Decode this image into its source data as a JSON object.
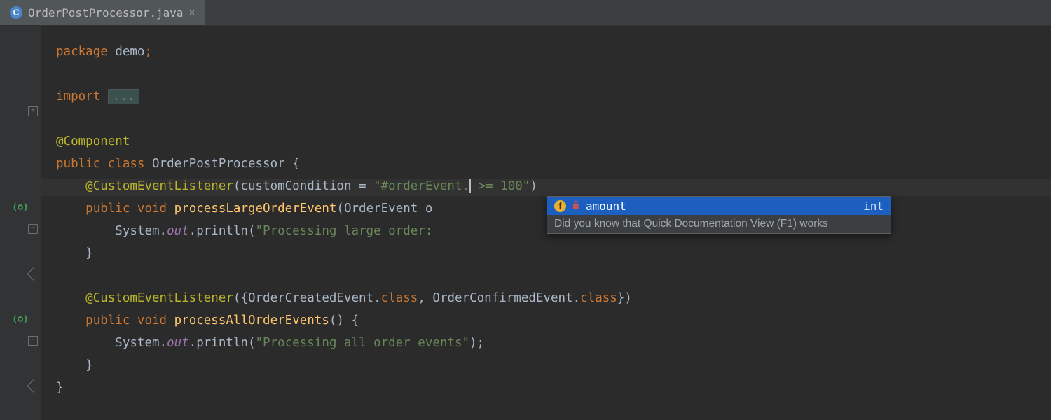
{
  "tab": {
    "filename": "OrderPostProcessor.java",
    "icon_letter": "C"
  },
  "code": {
    "l1": {
      "kw_package": "package",
      "pkg": "demo",
      "semi": ";"
    },
    "l3": {
      "kw_import": "import",
      "fold": "..."
    },
    "l5": {
      "ann": "@Component"
    },
    "l6": {
      "kw_public": "public",
      "kw_class": "class",
      "name": "OrderPostProcessor",
      "brace": " {"
    },
    "l7": {
      "ann": "@CustomEventListener",
      "paren_o": "(",
      "attr": "customCondition",
      "eq": " = ",
      "str_l": "\"#orderEvent.",
      "str_r": " >= 100\"",
      "paren_c": ")"
    },
    "l8": {
      "kw_public": "public",
      "kw_void": "void",
      "mname": "processLargeOrderEvent",
      "sig": "(OrderEvent o"
    },
    "l9": {
      "sys": "System.",
      "out": "out",
      "print": ".println(",
      "str": "\"Processing large order:"
    },
    "l10": {
      "brace": "}"
    },
    "l12": {
      "ann": "@CustomEventListener",
      "paren_o": "(",
      "brace_o": "{",
      "t1": "OrderCreatedEvent",
      "dot": ".",
      "kw_class": "class",
      "comma": ", ",
      "t2": "OrderConfirmedEvent",
      "brace_c": "}",
      "paren_c": ")"
    },
    "l13": {
      "kw_public": "public",
      "kw_void": "void",
      "mname": "processAllOrderEvents",
      "sig": "() {"
    },
    "l14": {
      "sys": "System.",
      "out": "out",
      "print": ".println(",
      "str": "\"Processing all order events\"",
      "close": ");"
    },
    "l15": {
      "brace": "}"
    },
    "l16": {
      "brace": "}"
    }
  },
  "completion": {
    "badge": "f",
    "lock": "🔒",
    "name": "amount",
    "type": "int",
    "tip": "Did you know that Quick Documentation View (F1) works"
  }
}
